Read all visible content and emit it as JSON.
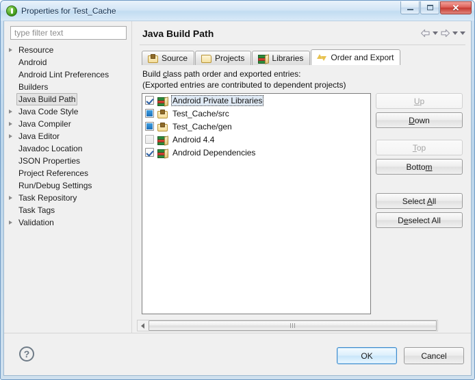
{
  "window": {
    "title": "Properties for Test_Cache",
    "icon": "eclipse-green-circle-icon",
    "controls": {
      "minimize": "minimize-icon",
      "maximize": "maximize-icon",
      "close": "✕"
    }
  },
  "sidebar": {
    "filter_placeholder": "type filter text",
    "filter_value": "",
    "items": [
      {
        "label": "Resource",
        "expandable": true,
        "selected": false
      },
      {
        "label": "Android",
        "expandable": false,
        "selected": false
      },
      {
        "label": "Android Lint Preferences",
        "expandable": false,
        "selected": false
      },
      {
        "label": "Builders",
        "expandable": false,
        "selected": false
      },
      {
        "label": "Java Build Path",
        "expandable": false,
        "selected": true
      },
      {
        "label": "Java Code Style",
        "expandable": true,
        "selected": false
      },
      {
        "label": "Java Compiler",
        "expandable": true,
        "selected": false
      },
      {
        "label": "Java Editor",
        "expandable": true,
        "selected": false
      },
      {
        "label": "Javadoc Location",
        "expandable": false,
        "selected": false
      },
      {
        "label": "JSON Properties",
        "expandable": false,
        "selected": false
      },
      {
        "label": "Project References",
        "expandable": false,
        "selected": false
      },
      {
        "label": "Run/Debug Settings",
        "expandable": false,
        "selected": false
      },
      {
        "label": "Task Repository",
        "expandable": true,
        "selected": false
      },
      {
        "label": "Task Tags",
        "expandable": false,
        "selected": false
      },
      {
        "label": "Validation",
        "expandable": true,
        "selected": false
      }
    ]
  },
  "main": {
    "page_title": "Java Build Path",
    "nav": {
      "back": "◁",
      "back_menu": "▾",
      "forward": "▷",
      "forward_menu": "▾",
      "view_menu": "▾"
    },
    "tabs": [
      {
        "label": "Source",
        "icon": "source-package-icon",
        "active": false
      },
      {
        "label": "Projects",
        "icon": "projects-folder-icon",
        "active": false
      },
      {
        "label": "Libraries",
        "icon": "libraries-books-icon",
        "active": false
      },
      {
        "label": "Order and Export",
        "icon": "order-export-arrows-icon",
        "active": true
      }
    ],
    "description_line1": "Build class path order and exported entries:",
    "description_line2": "(Exported entries are contributed to dependent projects)",
    "entries": [
      {
        "label": "Android Private Libraries",
        "icon": "library-books-icon",
        "check_state": "checked",
        "selected": true
      },
      {
        "label": "Test_Cache/src",
        "icon": "source-package-icon",
        "check_state": "filled",
        "selected": false
      },
      {
        "label": "Test_Cache/gen",
        "icon": "source-package-icon",
        "check_state": "filled",
        "selected": false
      },
      {
        "label": "Android 4.4",
        "icon": "library-books-icon",
        "check_state": "empty",
        "selected": false
      },
      {
        "label": "Android Dependencies",
        "icon": "library-books-icon",
        "check_state": "checked",
        "selected": false
      }
    ],
    "side_buttons": [
      {
        "label": "Up",
        "enabled": false
      },
      {
        "label": "Down",
        "enabled": true
      },
      {
        "label": "Top",
        "enabled": false
      },
      {
        "label": "Bottom",
        "enabled": true
      },
      {
        "label": "Select All",
        "enabled": true
      },
      {
        "label": "Deselect All",
        "enabled": true
      }
    ],
    "scrollbar": {
      "left_arrow": "◀",
      "grip": "|||"
    }
  },
  "footer": {
    "help_icon": "?",
    "ok_label": "OK",
    "cancel_label": "Cancel"
  },
  "colors": {
    "title_gradient_top": "#e9f2fb",
    "title_gradient_bottom": "#c2dcf1",
    "close_red": "#c63a31",
    "accent_blue": "#1c6fba",
    "ok_focus_border": "#3c8bcd",
    "dialog_bg": "#f0f0f0",
    "list_bg": "#ffffff",
    "selection_bg": "#dfe9f4"
  }
}
